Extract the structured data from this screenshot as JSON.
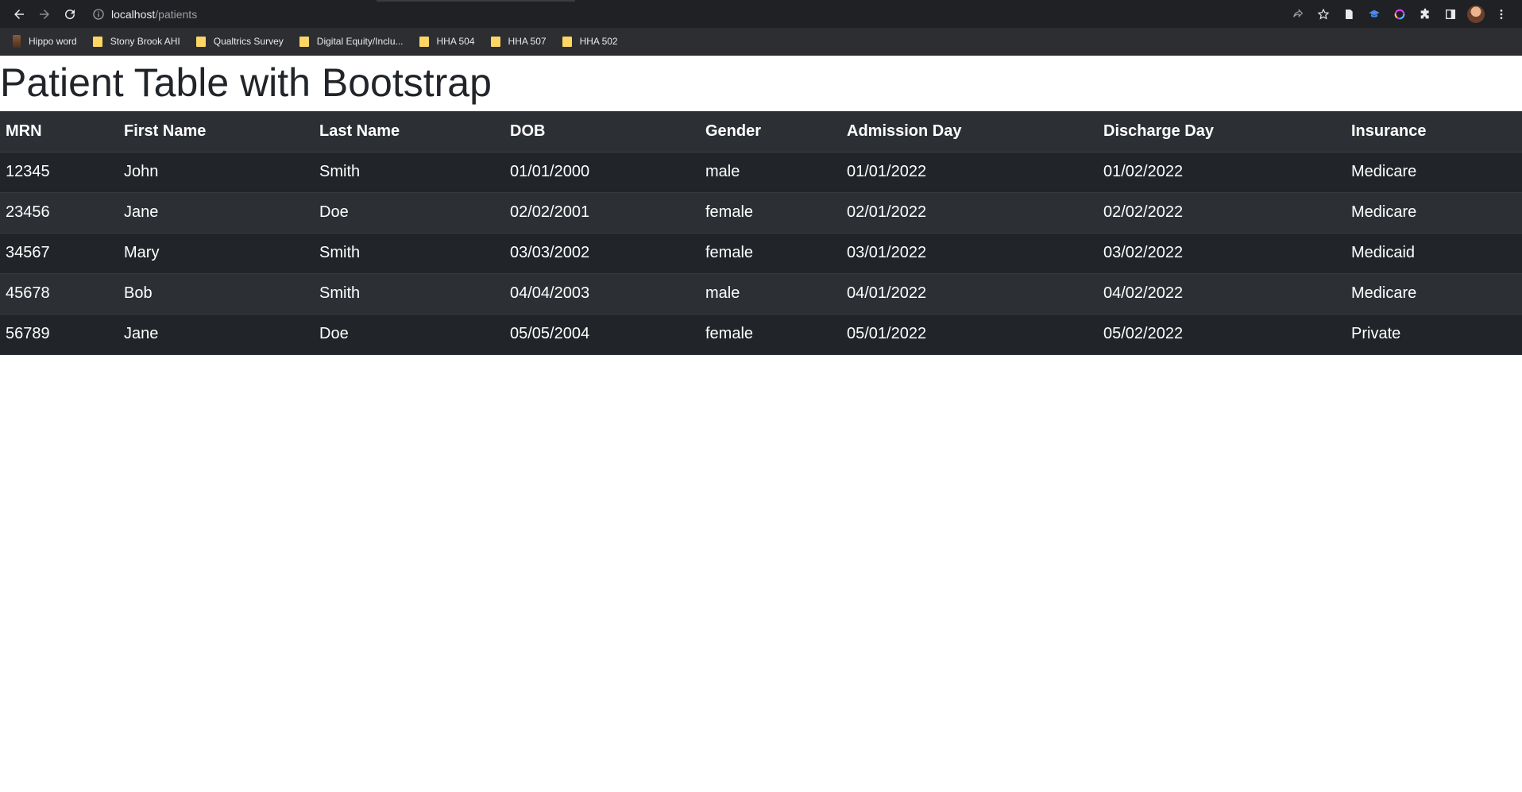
{
  "browser": {
    "url_host": "localhost",
    "url_path": "/patients",
    "bookmarks": [
      {
        "label": "Hippo word",
        "icon": "hippo-icon"
      },
      {
        "label": "Stony Brook AHI",
        "icon": "folder-icon"
      },
      {
        "label": "Qualtrics Survey",
        "icon": "folder-icon"
      },
      {
        "label": "Digital Equity/Inclu...",
        "icon": "folder-icon"
      },
      {
        "label": "HHA 504",
        "icon": "folder-icon"
      },
      {
        "label": "HHA 507",
        "icon": "folder-icon"
      },
      {
        "label": "HHA 502",
        "icon": "folder-icon"
      }
    ]
  },
  "page": {
    "title": "Patient Table with Bootstrap"
  },
  "table": {
    "headers": [
      "MRN",
      "First Name",
      "Last Name",
      "DOB",
      "Gender",
      "Admission Day",
      "Discharge Day",
      "Insurance"
    ],
    "rows": [
      [
        "12345",
        "John",
        "Smith",
        "01/01/2000",
        "male",
        "01/01/2022",
        "01/02/2022",
        "Medicare"
      ],
      [
        "23456",
        "Jane",
        "Doe",
        "02/02/2001",
        "female",
        "02/01/2022",
        "02/02/2022",
        "Medicare"
      ],
      [
        "34567",
        "Mary",
        "Smith",
        "03/03/2002",
        "female",
        "03/01/2022",
        "03/02/2022",
        "Medicaid"
      ],
      [
        "45678",
        "Bob",
        "Smith",
        "04/04/2003",
        "male",
        "04/01/2022",
        "04/02/2022",
        "Medicare"
      ],
      [
        "56789",
        "Jane",
        "Doe",
        "05/05/2004",
        "female",
        "05/01/2022",
        "05/02/2022",
        "Private"
      ]
    ]
  },
  "colors": {
    "table_dark": "#212529",
    "table_stripe": "#2c3034",
    "chrome_dark": "#202124",
    "bookmark_folder": "#fdd663"
  }
}
